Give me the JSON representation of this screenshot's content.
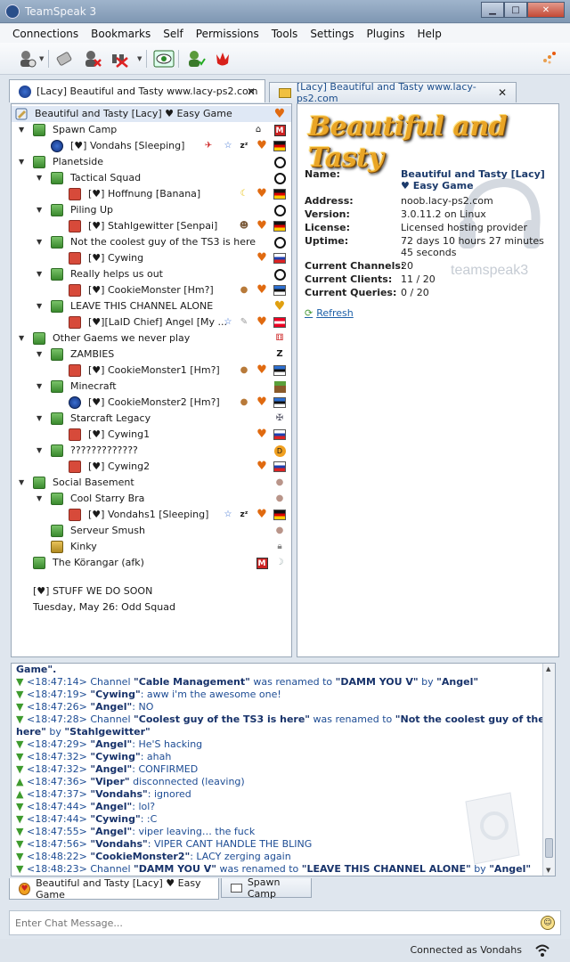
{
  "window": {
    "title": "TeamSpeak 3"
  },
  "menu": [
    "Connections",
    "Bookmarks",
    "Self",
    "Permissions",
    "Tools",
    "Settings",
    "Plugins",
    "Help"
  ],
  "server_tabs": [
    {
      "label": "[Lacy] Beautiful and Tasty www.lacy-ps2.com"
    },
    {
      "label": "[Lacy] Beautiful and Tasty www.lacy-ps2.com"
    }
  ],
  "tree": {
    "server_name": "Beautiful and Tasty [Lacy] ♥ Easy Game",
    "rows": [
      {
        "label": "Spawn Camp",
        "type": "channel",
        "indent": 0
      },
      {
        "label": "[♥] Vondahs [Sleeping]",
        "type": "user",
        "indent": 1
      },
      {
        "label": "Planetside",
        "type": "channel",
        "indent": 0
      },
      {
        "label": "Tactical Squad",
        "type": "channel",
        "indent": 1
      },
      {
        "label": "[♥] Hoffnung [Banana]",
        "type": "user",
        "indent": 2
      },
      {
        "label": "Piling Up",
        "type": "channel",
        "indent": 1
      },
      {
        "label": "[♥] Stahlgewitter [Senpai]",
        "type": "user",
        "indent": 2
      },
      {
        "label": "Not the coolest guy of the TS3 is here",
        "type": "channel",
        "indent": 1
      },
      {
        "label": "[♥] Cywing",
        "type": "user",
        "indent": 2
      },
      {
        "label": "Really helps us out",
        "type": "channel",
        "indent": 1
      },
      {
        "label": "[♥] CookieMonster [Hm?]",
        "type": "user",
        "indent": 2
      },
      {
        "label": "LEAVE THIS CHANNEL ALONE",
        "type": "channel",
        "indent": 1
      },
      {
        "label": "[♥][LaID Chief] Angel [My ...",
        "type": "user",
        "indent": 2
      },
      {
        "label": "Other Gaems we never play",
        "type": "channel",
        "indent": 0
      },
      {
        "label": "ZAMBIES",
        "type": "channel",
        "indent": 1
      },
      {
        "label": "[♥] CookieMonster1 [Hm?]",
        "type": "user",
        "indent": 2
      },
      {
        "label": "Minecraft",
        "type": "channel",
        "indent": 1
      },
      {
        "label": "[♥] CookieMonster2 [Hm?]",
        "type": "user",
        "indent": 2
      },
      {
        "label": "Starcraft Legacy",
        "type": "channel",
        "indent": 1
      },
      {
        "label": "[♥] Cywing1",
        "type": "user",
        "indent": 2
      },
      {
        "label": "?????????????",
        "type": "channel",
        "indent": 1
      },
      {
        "label": "[♥] Cywing2",
        "type": "user",
        "indent": 2
      },
      {
        "label": "Social Basement",
        "type": "channel",
        "indent": 0
      },
      {
        "label": "Cool Starry Bra",
        "type": "channel",
        "indent": 1
      },
      {
        "label": "[♥] Vondahs1 [Sleeping]",
        "type": "user",
        "indent": 2
      },
      {
        "label": "Serveur Smush",
        "type": "channel",
        "indent": 1
      },
      {
        "label": "Kinky",
        "type": "channel",
        "indent": 1
      },
      {
        "label": "The Körangar (afk)",
        "type": "channel",
        "indent": 0
      }
    ],
    "spacer_line1": "[♥] STUFF WE DO SOON",
    "spacer_line2": "Tuesday, May 26: Odd Squad"
  },
  "info": {
    "banner": "Beautiful and Tasty",
    "name_label": "Name:",
    "name_value": "Beautiful and Tasty [Lacy] ♥ Easy Game",
    "address_label": "Address:",
    "address_value": "noob.lacy-ps2.com",
    "version_label": "Version:",
    "version_value": "3.0.11.2 on Linux",
    "license_label": "License:",
    "license_value": "Licensed hosting provider",
    "uptime_label": "Uptime:",
    "uptime_value": "72 days 10 hours 27 minutes 45 seconds",
    "channels_label": "Current Channels:",
    "channels_value": "20",
    "clients_label": "Current Clients:",
    "clients_value": "11 / 20",
    "queries_label": "Current Queries:",
    "queries_value": "0 / 20",
    "refresh": "Refresh",
    "logo_text": "teamspeak3"
  },
  "chat": {
    "top_fragment": "Game\".",
    "lines": [
      {
        "time": "<18:47:14>",
        "parts": [
          "Channel ",
          "\"Cable Management\"",
          " was renamed to ",
          "\"DAMM YOU V\"",
          " by ",
          "\"Angel\""
        ]
      },
      {
        "time": "<18:47:19>",
        "parts": [
          "",
          "\"Cywing\"",
          ": aww i'm the awesome one!"
        ]
      },
      {
        "time": "<18:47:26>",
        "parts": [
          "",
          "\"Angel\"",
          ": NO"
        ]
      },
      {
        "time": "<18:47:28>",
        "parts": [
          "Channel ",
          "\"Coolest guy of the TS3 is here\"",
          " was renamed to ",
          "\"Not the coolest guy of the TS3 is"
        ]
      },
      {
        "time": "",
        "parts": [
          "here\"",
          " by ",
          "\"Stahlgewitter\""
        ]
      },
      {
        "time": "<18:47:29>",
        "parts": [
          "",
          "\"Angel\"",
          ": He'S hacking"
        ]
      },
      {
        "time": "<18:47:32>",
        "parts": [
          "",
          "\"Cywing\"",
          ": ahah"
        ]
      },
      {
        "time": "<18:47:32>",
        "parts": [
          "",
          "\"Angel\"",
          ": CONFIRMED"
        ]
      },
      {
        "time": "<18:47:36>",
        "parts": [
          "",
          "\"Viper\"",
          " disconnected (leaving)"
        ]
      },
      {
        "time": "<18:47:37>",
        "parts": [
          "",
          "\"Vondahs\"",
          ": ignored"
        ]
      },
      {
        "time": "<18:47:44>",
        "parts": [
          "",
          "\"Angel\"",
          ": lol?"
        ]
      },
      {
        "time": "<18:47:44>",
        "parts": [
          "",
          "\"Cywing\"",
          ": :C"
        ]
      },
      {
        "time": "<18:47:55>",
        "parts": [
          "",
          "\"Angel\"",
          ": viper leaving… the fuck"
        ]
      },
      {
        "time": "<18:47:56>",
        "parts": [
          "",
          "\"Vondahs\"",
          ": VIPER CANT HANDLE THE BLING"
        ]
      },
      {
        "time": "<18:48:22>",
        "parts": [
          "",
          "\"CookieMonster2\"",
          ": LACY zerging again"
        ]
      },
      {
        "time": "<18:48:23>",
        "parts": [
          "Channel ",
          "\"DAMM YOU V\"",
          " was renamed to ",
          "\"LEAVE THIS CHANNEL ALONE\"",
          " by ",
          "\"Angel\""
        ]
      }
    ]
  },
  "chat_tabs": [
    {
      "label": "Beautiful and Tasty [Lacy] ♥ Easy Game"
    },
    {
      "label": "Spawn Camp"
    }
  ],
  "chat_input": {
    "placeholder": "Enter Chat Message..."
  },
  "status": {
    "text": "Connected as Vondahs"
  },
  "colors": {
    "accent": "#1c4e8c",
    "green_arrow": "#3e9b2e",
    "heart": "#e06a10"
  }
}
